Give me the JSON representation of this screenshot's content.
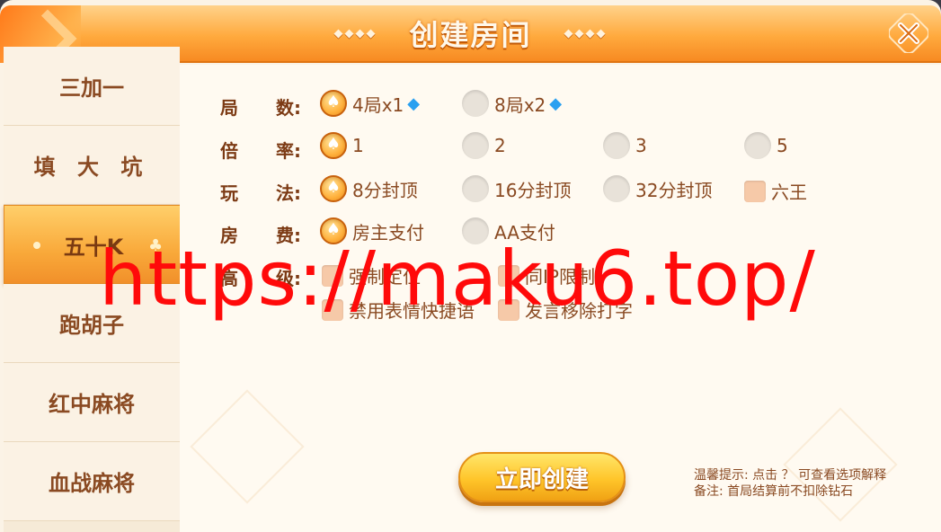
{
  "header": {
    "title": "创建房间",
    "left_diamonds": "◆◆◆◆",
    "right_diamonds": "◆◆◆◆",
    "close_icon": "close-icon"
  },
  "sidebar": {
    "items": [
      {
        "label": "三加一",
        "active": false
      },
      {
        "label": "填 大 坑",
        "active": false
      },
      {
        "label": "五十K",
        "active": true
      },
      {
        "label": "跑胡子",
        "active": false
      },
      {
        "label": "红中麻将",
        "active": false
      },
      {
        "label": "血战麻将",
        "active": false
      }
    ]
  },
  "options": {
    "rounds": {
      "label_a": "局",
      "label_b": "数:",
      "choices": [
        {
          "text": "4局x1",
          "selected": true,
          "icon": "diamond-gem-icon"
        },
        {
          "text": "8局x2",
          "selected": false,
          "icon": "diamond-gem-icon"
        }
      ]
    },
    "multiplier": {
      "label_a": "倍",
      "label_b": "率:",
      "choices": [
        {
          "text": "1",
          "selected": true
        },
        {
          "text": "2",
          "selected": false
        },
        {
          "text": "3",
          "selected": false
        },
        {
          "text": "5",
          "selected": false
        }
      ]
    },
    "play": {
      "label_a": "玩",
      "label_b": "法:",
      "choices": [
        {
          "text": "8分封顶",
          "selected": true
        },
        {
          "text": "16分封顶",
          "selected": false
        },
        {
          "text": "32分封顶",
          "selected": false
        },
        {
          "text": "六王",
          "selected": false,
          "type": "checkbox"
        }
      ]
    },
    "fee": {
      "label_a": "房",
      "label_b": "费:",
      "choices": [
        {
          "text": "房主支付",
          "selected": true
        },
        {
          "text": "AA支付",
          "selected": false
        }
      ]
    },
    "advanced": {
      "label_a": "高",
      "label_b": "级:",
      "choices": [
        {
          "text": "强制定位",
          "checked": false
        },
        {
          "text": "同IP限制",
          "checked": false
        },
        {
          "text": "禁用表情快捷语",
          "checked": false
        },
        {
          "text": "发言移除打字",
          "checked": false
        }
      ]
    }
  },
  "create_button": {
    "label": "立即创建"
  },
  "tips": {
    "line1": "温馨提示: 点击 ？ 可查看选项解释",
    "line2": "备注: 首局结算前不扣除钻石"
  },
  "watermark": "https://maku6.top/",
  "colors": {
    "header_orange": "#ffaa3e",
    "text_brown": "#8a4a22",
    "watermark_red": "#ff0a0a"
  }
}
